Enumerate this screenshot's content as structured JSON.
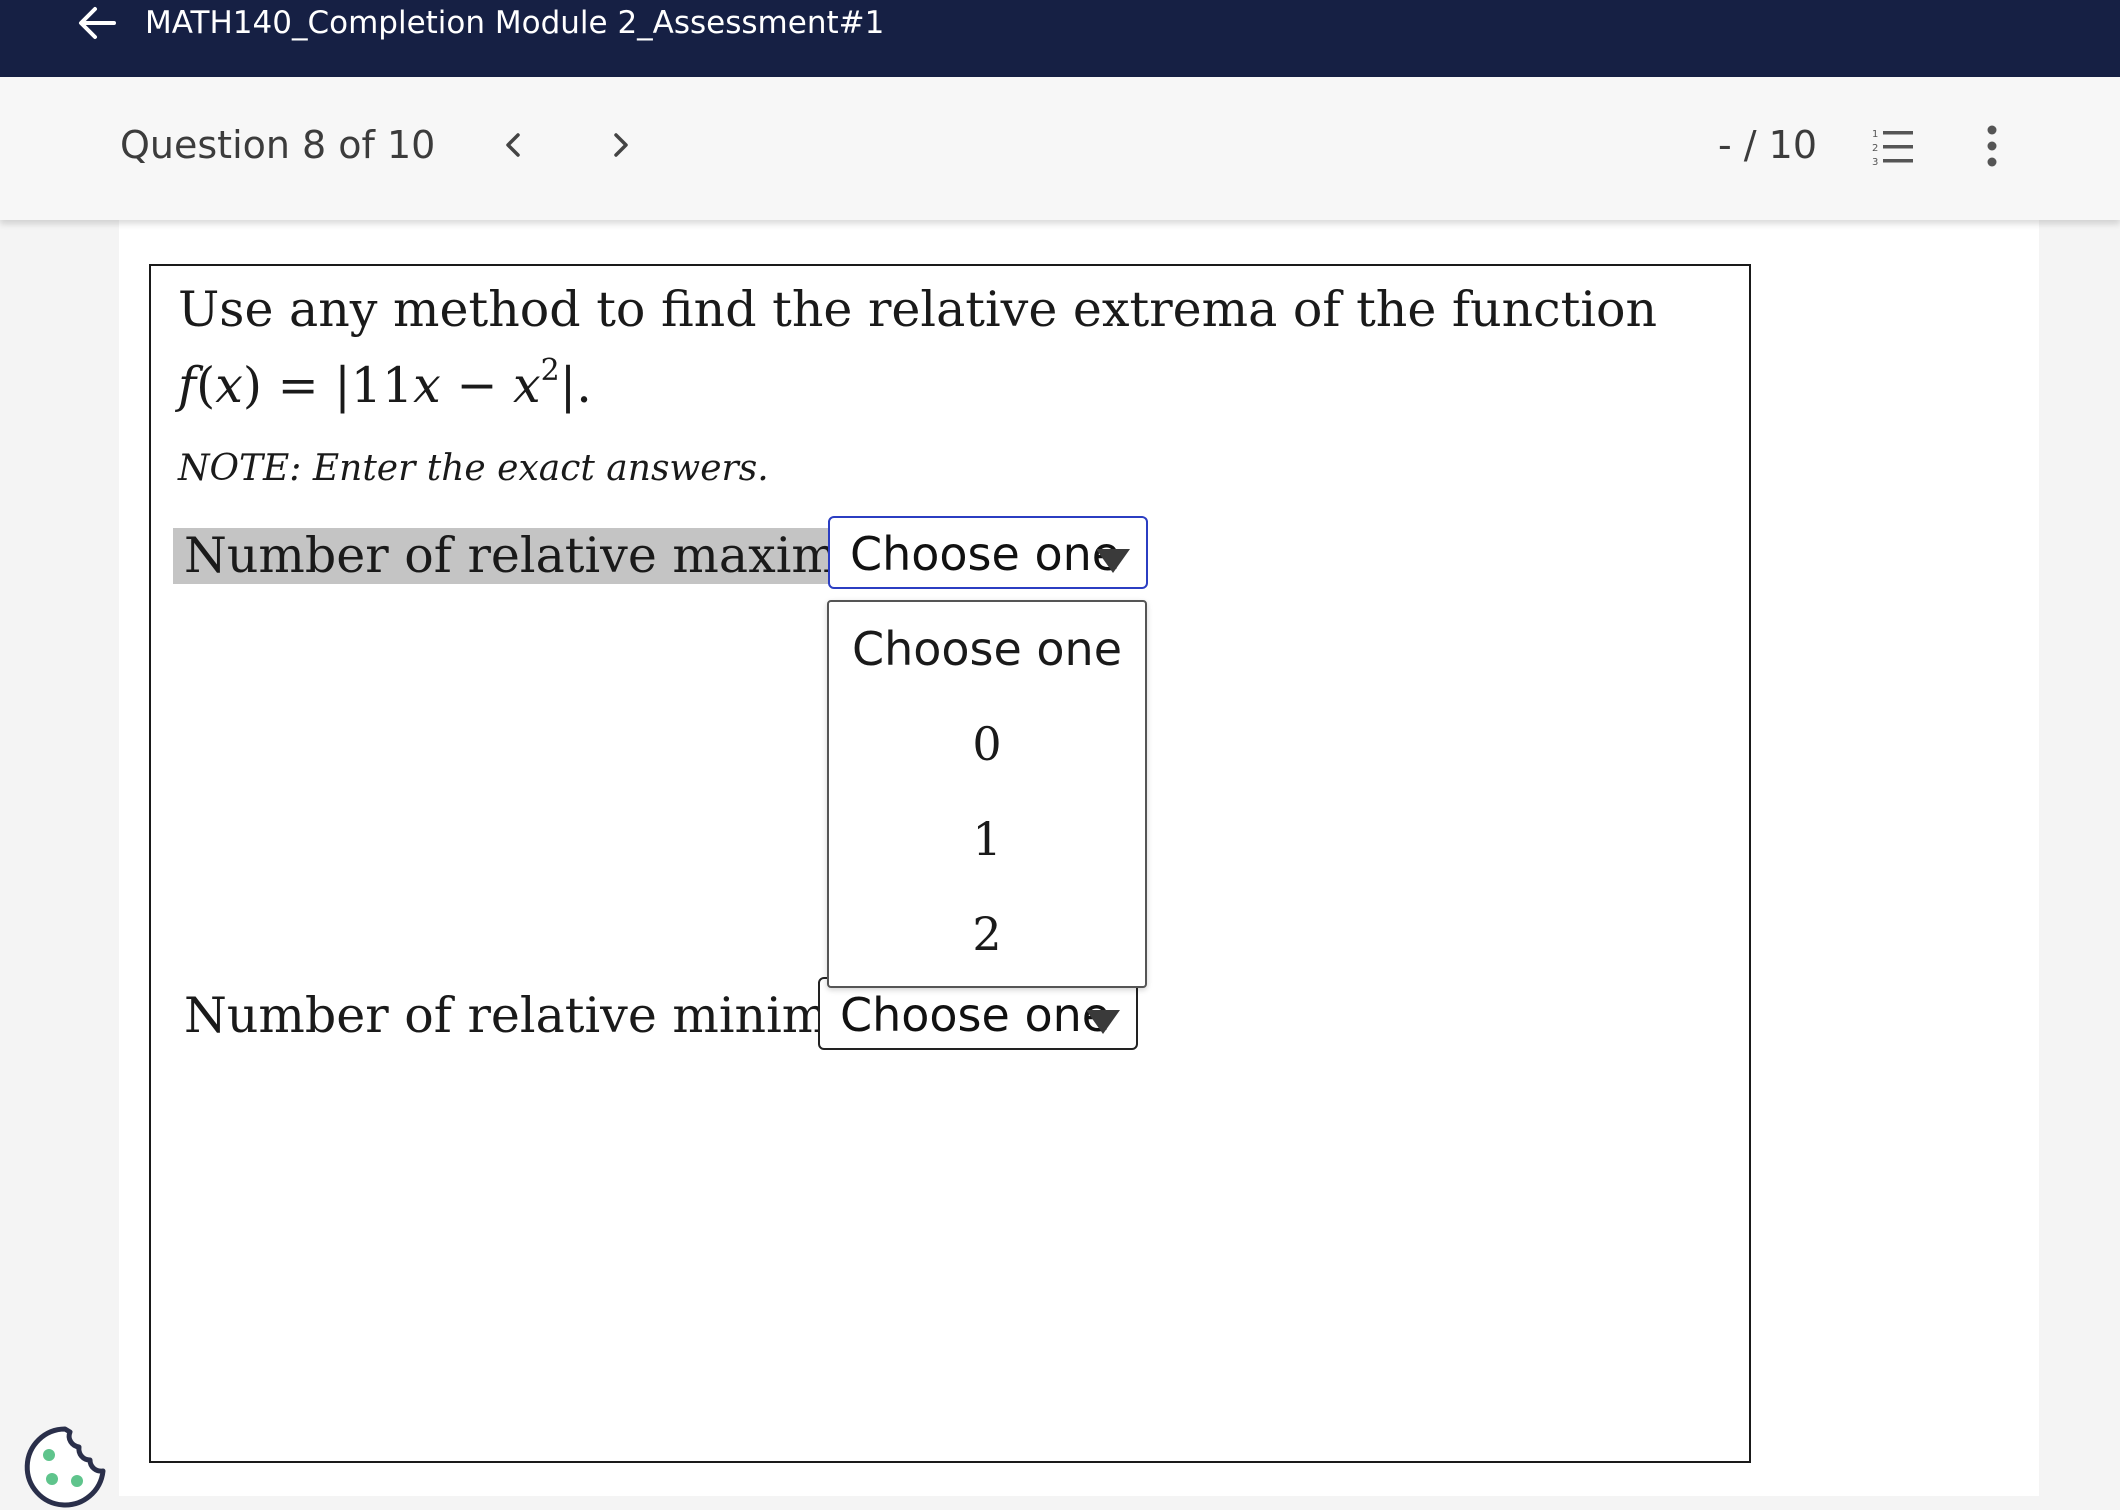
{
  "header": {
    "title": "MATH140_Completion Module 2_Assessment#1",
    "back_icon": "arrow-left-icon",
    "background_color": "#162044"
  },
  "question_nav": {
    "counter": "Question 8 of 10",
    "prev_icon": "chevron-left-icon",
    "next_icon": "chevron-right-icon",
    "score": "- / 10",
    "list_icon": "numbered-list-icon",
    "more_icon": "more-vertical-icon"
  },
  "question": {
    "prompt": "Use any method to find the relative extrema of the function",
    "formula": {
      "lhs": "f",
      "arg_open": "(",
      "arg": "x",
      "arg_close": ")",
      "equals": " = ",
      "abs_open": "|",
      "coef": "11",
      "var1": "x",
      "minus": " − ",
      "var2": "x",
      "exponent": "2",
      "abs_close": "|",
      "period": "."
    },
    "note": "NOTE: Enter the exact answers.",
    "fields": {
      "maxima_label": "Number of relative maxima:",
      "maxima_value": "Choose one",
      "minima_label": "Number of relative minima:",
      "minima_value": "Choose one"
    },
    "dropdown_options": [
      "Choose one",
      "0",
      "1",
      "2"
    ]
  },
  "colors": {
    "accent_focus": "#2b3ec2",
    "highlight": "#c4c4c4",
    "cookie_icon": "#2a2f4a",
    "cookie_dots": "#5fc48c"
  },
  "cookie_icon": "cookie-icon"
}
